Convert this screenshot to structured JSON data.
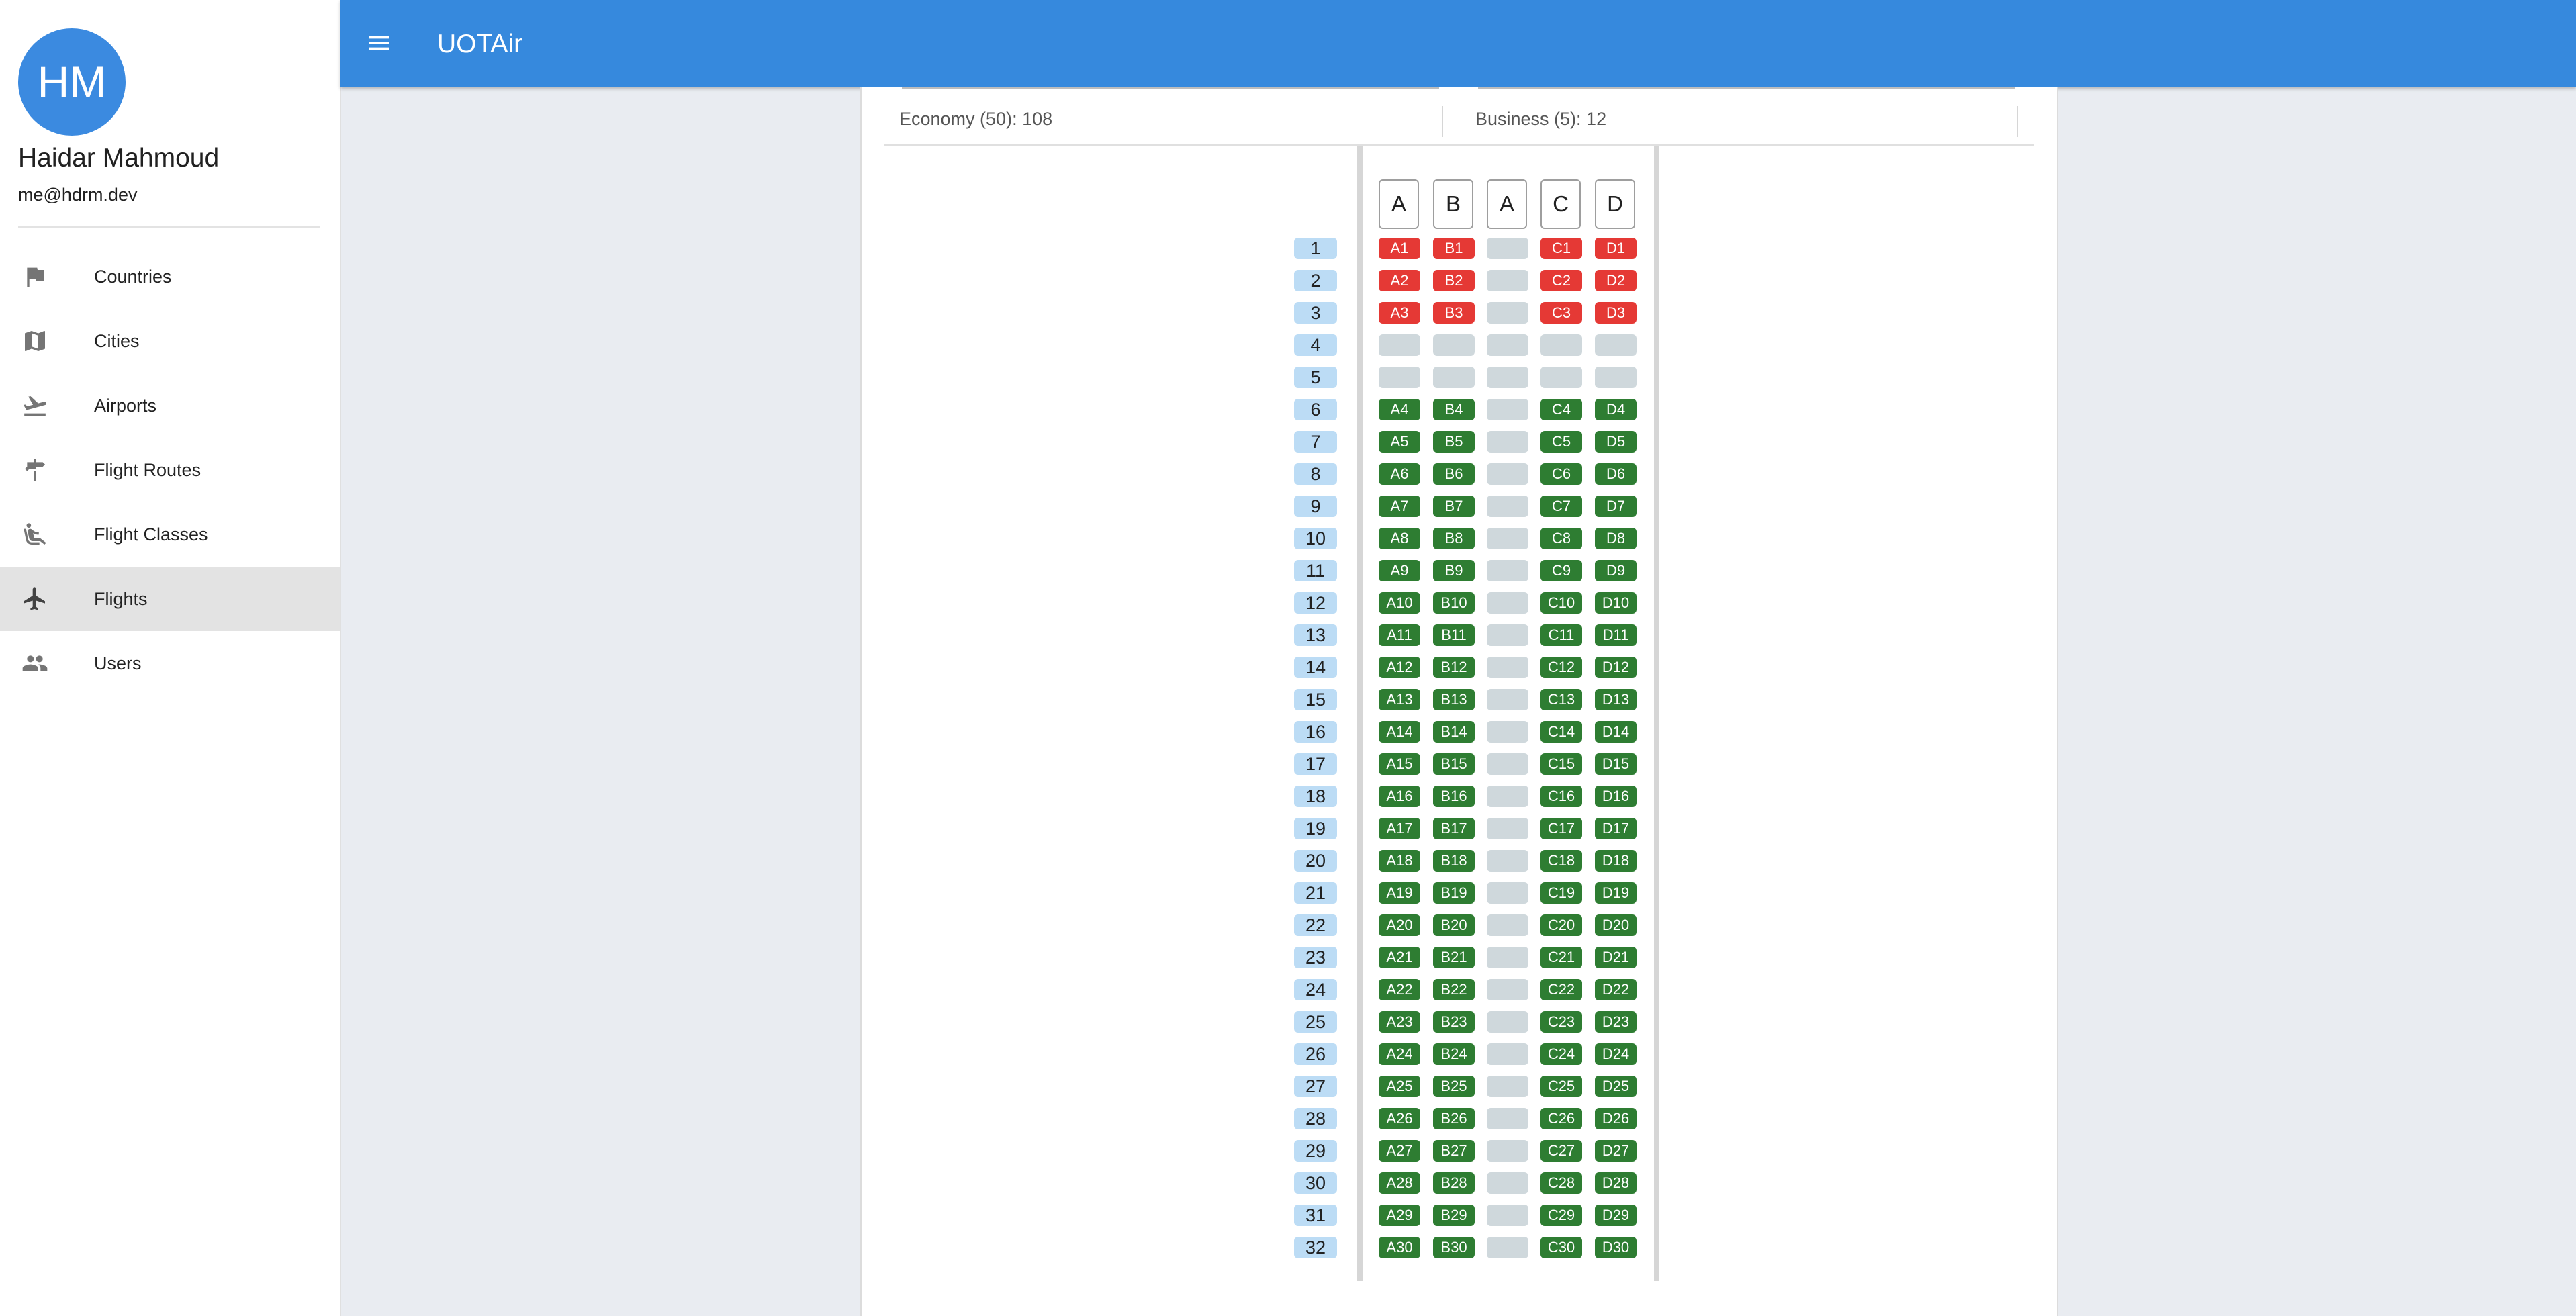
{
  "user": {
    "initials": "HM",
    "name": "Haidar Mahmoud",
    "email": "me@hdrm.dev"
  },
  "nav": [
    {
      "label": "Countries",
      "icon": "flag-icon",
      "active": false
    },
    {
      "label": "Cities",
      "icon": "map-icon",
      "active": false
    },
    {
      "label": "Airports",
      "icon": "flight-takeoff-icon",
      "active": false
    },
    {
      "label": "Flight Routes",
      "icon": "signpost-icon",
      "active": false
    },
    {
      "label": "Flight Classes",
      "icon": "seat-icon",
      "active": false
    },
    {
      "label": "Flights",
      "icon": "airplane-icon",
      "active": true
    },
    {
      "label": "Users",
      "icon": "people-icon",
      "active": false
    }
  ],
  "app": {
    "title": "UOTAir"
  },
  "classes": [
    {
      "text": "Economy (50): 108"
    },
    {
      "text": "Business (5): 12"
    }
  ],
  "seatmap": {
    "columns": [
      "A",
      "B",
      "A",
      "C",
      "D"
    ],
    "rows": 32,
    "taken_rows": [
      1,
      2,
      3
    ],
    "empty_rows": [
      4,
      5
    ],
    "colors": {
      "taken": "#e53935",
      "free": "#2e7d32",
      "empty": "#cfd8dc",
      "row_number": "#bcdcf5"
    }
  },
  "colors": {
    "topbar": "#3689dd",
    "avatar": "#3b8ae0",
    "background": "#e9ecf1"
  }
}
